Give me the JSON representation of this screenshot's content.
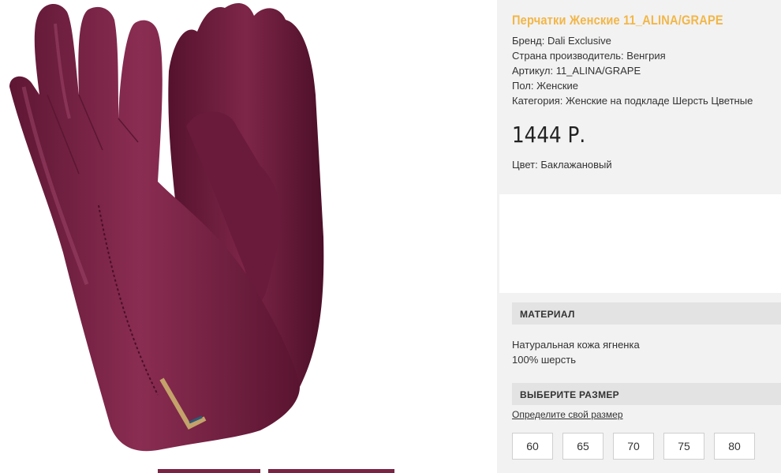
{
  "product": {
    "title": "Перчатки Женские 11_ALINA/GRAPE",
    "properties": [
      "Бренд: Dali Exclusive",
      "Страна производитель: Венгрия",
      "Артикул: 11_ALINA/GRAPE",
      "Пол: Женские",
      "Категория: Женские на подкладе Шерсть Цветные"
    ],
    "price": "1444 Р.",
    "color_line": "Цвет: Баклажановый"
  },
  "material": {
    "header": "МАТЕРИАЛ",
    "lines": [
      "Натуральная кожа ягненка",
      "100% шерсть"
    ]
  },
  "size": {
    "header": "ВЫБЕРИТЕ РАЗМЕР",
    "link": "Определите свой размер",
    "options": [
      "60",
      "65",
      "70",
      "75",
      "80"
    ]
  },
  "colors": {
    "accent": "#f2b648",
    "glove": "#7a2444",
    "panel_bg": "#f2f2f2",
    "header_bg": "#e3e3e3"
  }
}
